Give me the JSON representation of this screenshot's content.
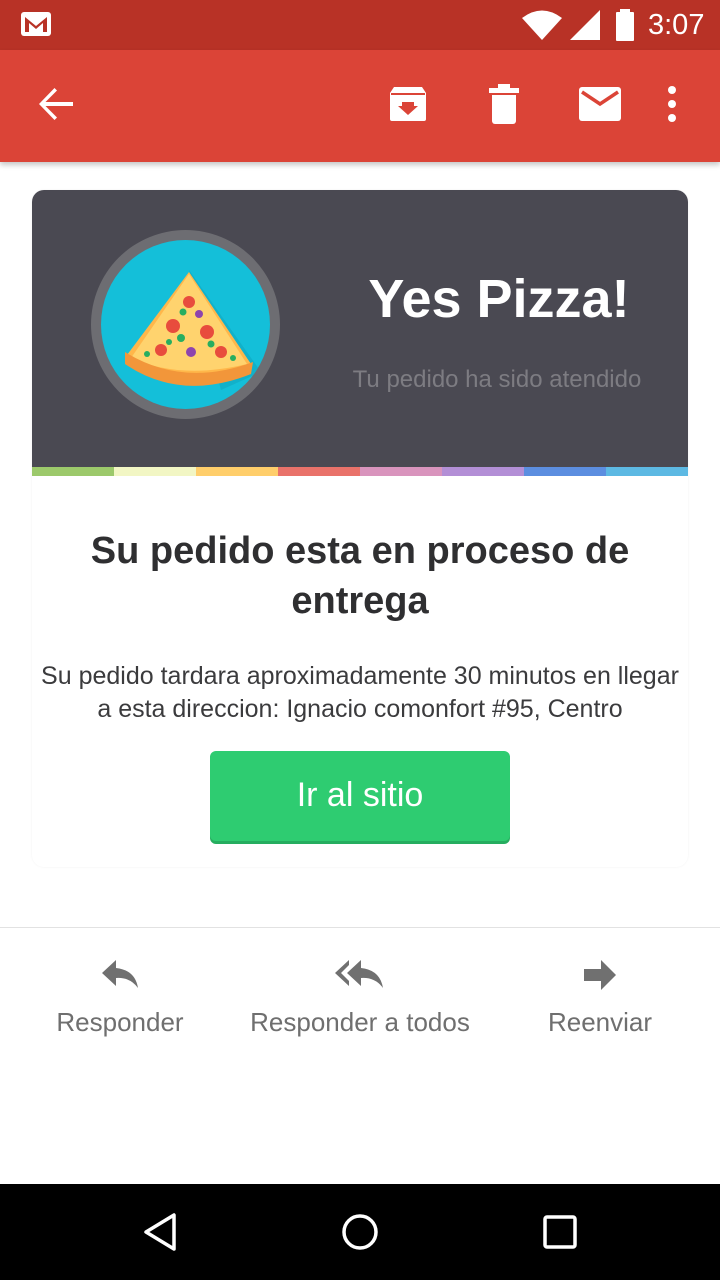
{
  "status_bar": {
    "time": "3:07",
    "icons": [
      "gmail-icon",
      "wifi-icon",
      "signal-icon",
      "battery-icon"
    ]
  },
  "toolbar": {
    "icons": [
      "arrow-back-icon",
      "archive-icon",
      "delete-icon",
      "mark-unread-icon",
      "more-vert-icon"
    ]
  },
  "email": {
    "brand": "Yes Pizza!",
    "tagline": "Tu pedido ha sido atendido",
    "logo": "pizza-slice-icon",
    "stripe_colors": [
      "#9cc96b",
      "#f2f6c4",
      "#ffce6b",
      "#e9726a",
      "#d994bd",
      "#b38fd6",
      "#5c8ee0",
      "#5db9e3"
    ],
    "headline": "Su pedido esta en proceso de entrega",
    "body": "Su pedido tardara aproximadamente 30 minutos en llegar a esta direccion: Ignacio comonfort #95, Centro",
    "cta_label": "Ir al sitio"
  },
  "actions": [
    {
      "label": "Responder",
      "icon": "reply-icon"
    },
    {
      "label": "Responder a todos",
      "icon": "reply-all-icon"
    },
    {
      "label": "Reenviar",
      "icon": "forward-icon"
    }
  ],
  "colors": {
    "status_bar": "#b83226",
    "toolbar": "#db4437",
    "banner": "#4a4952",
    "cta": "#2ecc71",
    "logo_disc": "#14bfd9"
  },
  "nav_bar": {
    "icons": [
      "nav-back-icon",
      "nav-home-icon",
      "nav-recents-icon"
    ]
  }
}
